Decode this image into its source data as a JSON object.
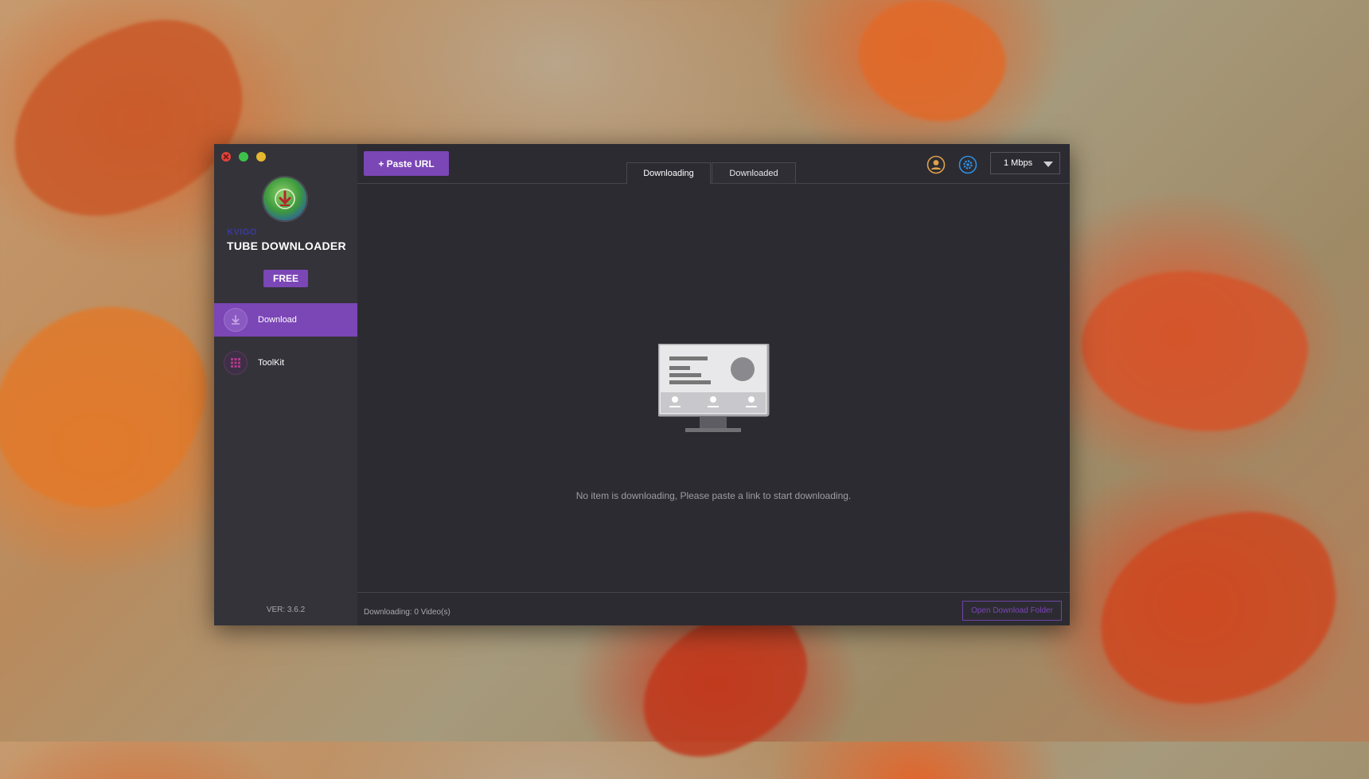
{
  "window": {
    "controls": [
      "close-icon",
      "maximize-icon",
      "minimize-icon"
    ]
  },
  "sidebar": {
    "brand_small": "KVIGO",
    "brand_title": "TUBE DOWNLOADER",
    "badge": "FREE",
    "items": [
      {
        "label": "Download",
        "icon": "download-icon",
        "active": true
      },
      {
        "label": "ToolKit",
        "icon": "grid-icon",
        "active": false
      }
    ],
    "version": "VER: 3.6.2"
  },
  "header": {
    "paste_label": "+ Paste URL",
    "tabs": [
      {
        "label": "Downloading",
        "active": true
      },
      {
        "label": "Downloaded",
        "active": false
      }
    ],
    "account_icon": "user-icon",
    "settings_icon": "gear-icon",
    "speed_value": "1 Mbps"
  },
  "main": {
    "empty_message": "No item is downloading, Please paste a link to start downloading.",
    "illustration_icon": "monitor-icon"
  },
  "footer": {
    "status": "Downloading: 0 Video(s)",
    "open_folder_label": "Open Download Folder"
  },
  "colors": {
    "accent": "#7b46b6",
    "window_bg": "#2c2b32",
    "sidebar_bg": "#343339",
    "close": "#e0443e",
    "maximize": "#3ec14a",
    "minimize": "#e6b82e"
  }
}
